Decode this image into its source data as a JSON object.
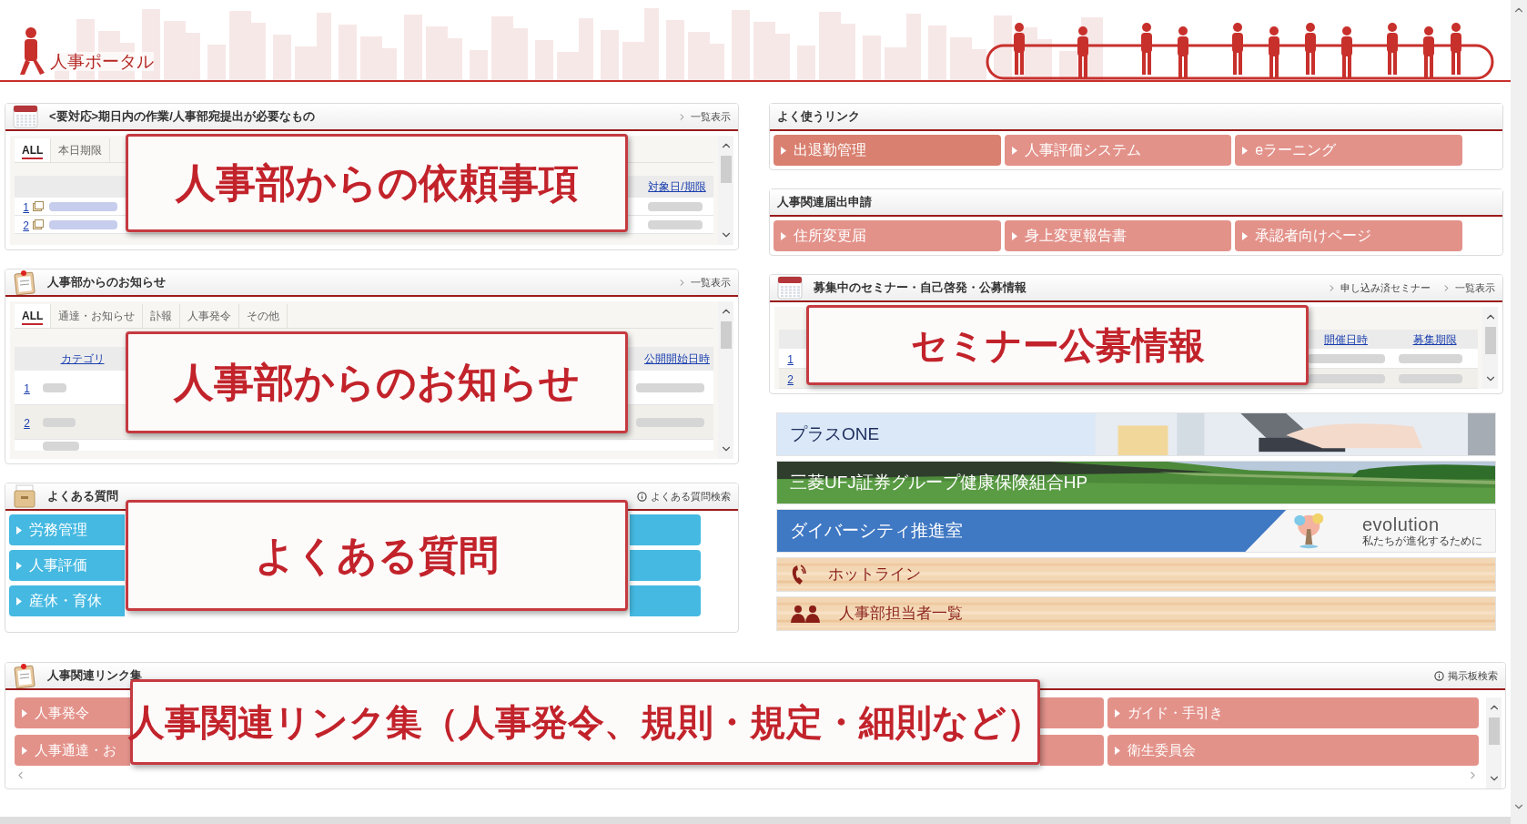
{
  "header": {
    "title": "人事ポータル"
  },
  "requests": {
    "title": "<要対応>期日内の作業/人事部宛提出が必要なもの",
    "list_link": "一覧表示",
    "callout": "人事部からの依頼事項",
    "tabs": [
      {
        "label": "ALL",
        "selected": true
      },
      {
        "label": "本日期限",
        "selected": false
      }
    ],
    "columns": [
      "対象日/期限"
    ],
    "rows": [
      {
        "number": "1"
      },
      {
        "number": "2"
      }
    ]
  },
  "notices": {
    "title": "人事部からのお知らせ",
    "list_link": "一覧表示",
    "callout": "人事部からのお知らせ",
    "tabs": [
      {
        "label": "ALL",
        "selected": true
      },
      {
        "label": "通達・お知らせ",
        "selected": false
      },
      {
        "label": "訃報",
        "selected": false
      },
      {
        "label": "人事発令",
        "selected": false
      },
      {
        "label": "その他",
        "selected": false
      }
    ],
    "columns": [
      "カテゴリ",
      "公開開始日時"
    ],
    "rows": [
      {
        "number": "1"
      },
      {
        "number": "2"
      }
    ]
  },
  "faq": {
    "title": "よくある質問",
    "search_link": "よくある質問検索",
    "callout": "よくある質問",
    "buttons": [
      "労務管理",
      "人事評価",
      "産休・育休"
    ]
  },
  "quick_links": {
    "title": "よく使うリンク",
    "buttons": [
      {
        "label": "出退勤管理",
        "selected": true
      },
      {
        "label": "人事評価システム",
        "selected": false
      },
      {
        "label": "eラーニング",
        "selected": false
      }
    ]
  },
  "forms": {
    "title": "人事関連届出申請",
    "buttons": [
      {
        "label": "住所変更届",
        "selected": false
      },
      {
        "label": "身上変更報告書",
        "selected": false
      },
      {
        "label": "承認者向けページ",
        "selected": false
      }
    ]
  },
  "seminars": {
    "title": "募集中のセミナー・自己啓発・公募情報",
    "links": [
      "申し込み済セミナー",
      "一覧表示"
    ],
    "callout": "セミナー公募情報",
    "columns": [
      "開催日時",
      "募集期限"
    ],
    "rows": [
      {
        "number": "1"
      },
      {
        "number": "2"
      }
    ]
  },
  "banners": [
    {
      "kind": "office",
      "label": "プラスONE"
    },
    {
      "kind": "field",
      "label": "三菱UFJ証券グループ健康保険組合HP"
    },
    {
      "kind": "diversity",
      "label": "ダイバーシティ推進室",
      "logo": "evolution",
      "tagline": "私たちが進化するために"
    },
    {
      "kind": "phone",
      "label": "ホットライン"
    },
    {
      "kind": "staff",
      "label": "人事部担当者一覧"
    }
  ],
  "links_panel": {
    "title": "人事関連リンク集",
    "search_link": "掲示板検索",
    "callout": "人事関連リンク集（人事発令、規則・規定・細則など）",
    "rows": [
      {
        "first": "人事発令",
        "last": "ガイド・手引き"
      },
      {
        "first": "人事通達・お",
        "last": "衛生委員会"
      }
    ]
  }
}
